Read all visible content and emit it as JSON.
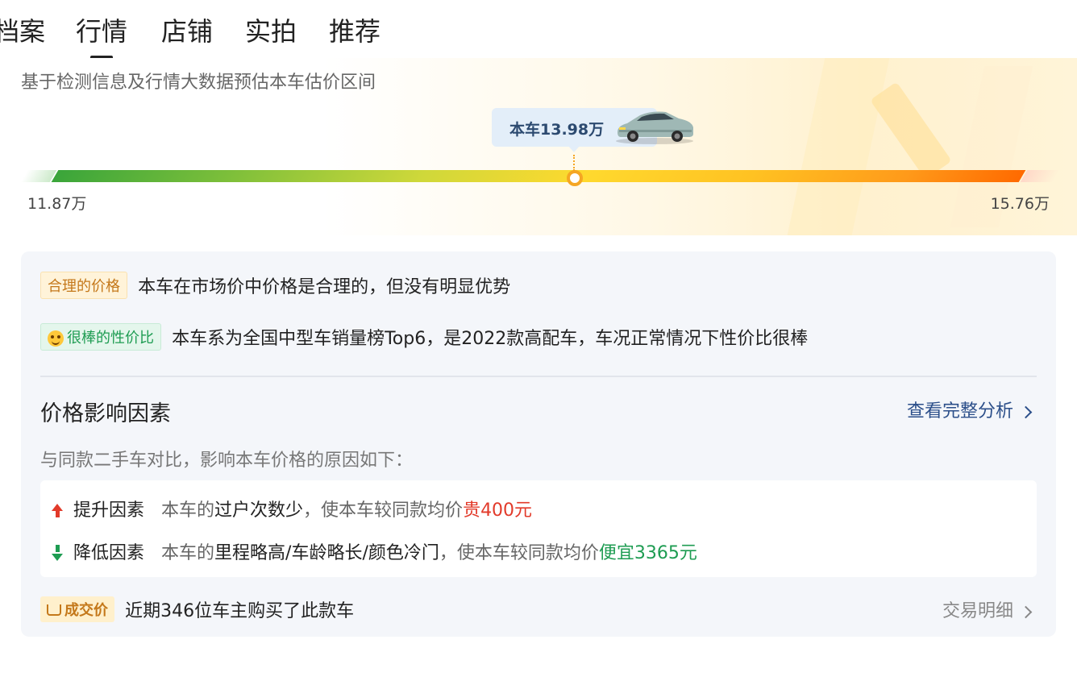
{
  "tabs": [
    {
      "label": "档案",
      "active": false
    },
    {
      "label": "行情",
      "active": true
    },
    {
      "label": "店铺",
      "active": false
    },
    {
      "label": "实拍",
      "active": false
    },
    {
      "label": "推荐",
      "active": false
    }
  ],
  "valuation": {
    "subtitle": "基于检测信息及行情大数据预估本车估价区间",
    "current_label": "本车13.98万",
    "min_label": "11.87万",
    "max_label": "15.76万",
    "current_value": 13.98,
    "min_value": 11.87,
    "max_value": 15.76,
    "bar_colors": [
      "#3aa53a",
      "#ffd92e",
      "#ff6a00"
    ]
  },
  "assessments": [
    {
      "tag": "合理的价格",
      "text": "本车在市场价中价格是合理的，但没有明显优势"
    },
    {
      "tag": "很棒的性价比",
      "text": "本车系为全国中型车销量榜Top6，是2022款高配车，车况正常情况下性价比很棒"
    }
  ],
  "factors": {
    "title": "价格影响因素",
    "link_label": "查看完整分析",
    "desc": "与同款二手车对比，影响本车价格的原因如下：",
    "up": {
      "label": "提升因素",
      "prefix": "本车的",
      "reason": "过户次数少",
      "mid": "，使本车较同款均价",
      "effect": "贵400元"
    },
    "down": {
      "label": "降低因素",
      "prefix": "本车的",
      "reason": "里程略高/车龄略长/颜色冷门",
      "mid": "，使本车较同款均价",
      "effect": "便宜3365元"
    }
  },
  "deal": {
    "tag": "成交价",
    "text": "近期346位车主购买了此款车",
    "link_label": "交易明细"
  },
  "colors": {
    "accent_link": "#2c4f8a",
    "up_red": "#e23a2a",
    "down_green": "#1e9c52",
    "tag_gold": "#c4781a"
  },
  "icons": [
    "car-image",
    "smile-emoji-icon",
    "arrow-up-icon",
    "arrow-down-icon",
    "chevron-right-icon",
    "deal-icon"
  ]
}
